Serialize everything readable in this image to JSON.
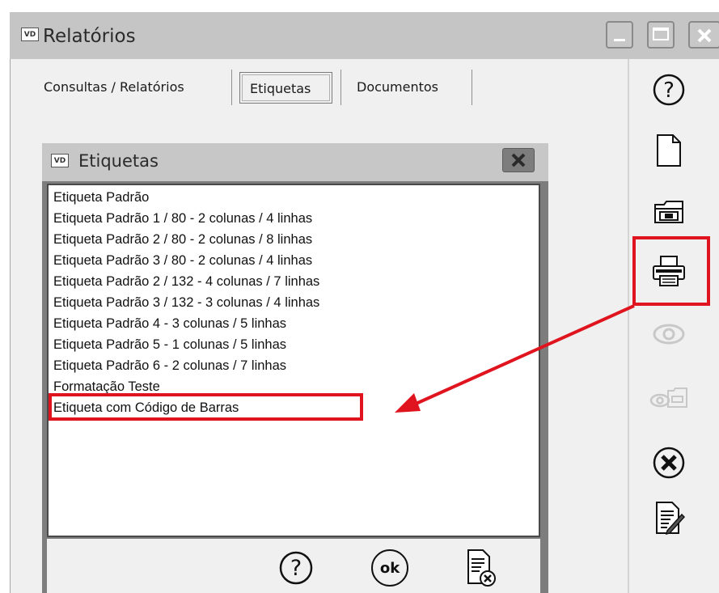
{
  "window": {
    "logo_text": "VD",
    "title": "Relatórios"
  },
  "tabs": [
    {
      "label": "Consultas / Relatórios",
      "selected": false
    },
    {
      "label": "Etiquetas",
      "selected": true
    },
    {
      "label": "Documentos",
      "selected": false
    }
  ],
  "toolbar": {
    "help_icon": "help-icon",
    "new_icon": "new-document-icon",
    "open_icon": "open-folder-icon",
    "print_icon": "printer-icon",
    "preview_icon": "eye-icon",
    "preview_folder_icon": "eye-folder-icon",
    "cancel_icon": "cancel-icon",
    "edit_icon": "edit-document-icon"
  },
  "dialog": {
    "logo_text": "VD",
    "title": "Etiquetas",
    "items": [
      "Etiqueta Padrão",
      "Etiqueta Padrão 1 / 80 - 2 colunas / 4 linhas",
      "Etiqueta Padrão 2 / 80 - 2 colunas / 8 linhas",
      "Etiqueta Padrão 3 / 80 - 2 colunas / 4 linhas",
      "Etiqueta Padrão 2 / 132 - 4 colunas / 7 linhas",
      "Etiqueta Padrão 3 / 132 - 3 colunas / 4 linhas",
      "Etiqueta Padrão 4  - 3 colunas / 5 linhas",
      "Etiqueta Padrão 5  - 1 colunas / 5 linhas",
      "Etiqueta Padrão 6  - 2 colunas / 7 linhas",
      "Formatação Teste",
      "Etiqueta com Código de Barras"
    ],
    "footer": {
      "help_icon": "help-icon",
      "ok_label": "ok",
      "cancel_icon": "cancel-document-icon"
    }
  },
  "colors": {
    "annotation": "#e0141e",
    "titlebar": "#c5c5c5",
    "dialog_frame": "#7d7d7d"
  }
}
